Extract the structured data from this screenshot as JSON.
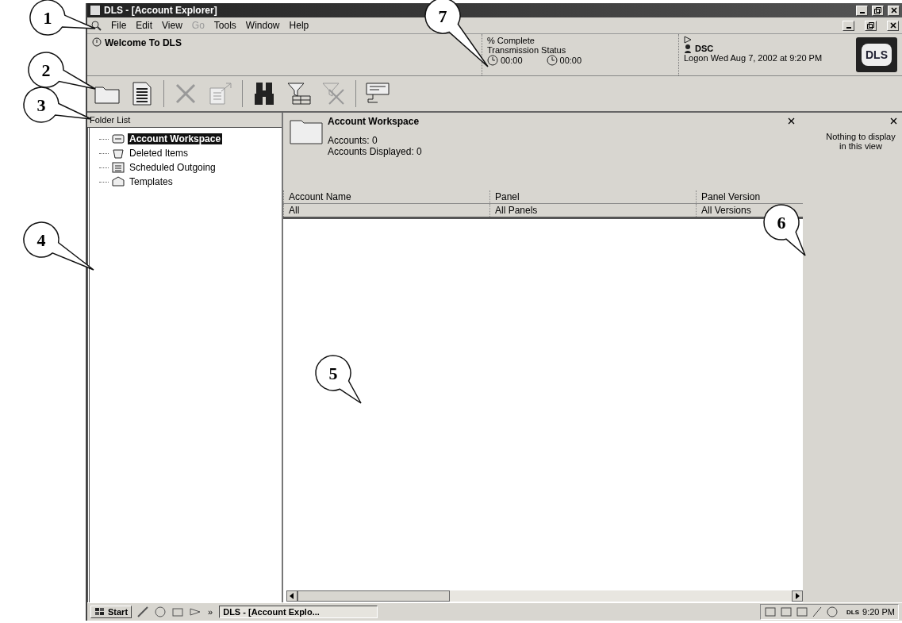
{
  "window": {
    "title": "DLS - [Account Explorer]"
  },
  "menu": [
    {
      "label": "File",
      "disabled": false
    },
    {
      "label": "Edit",
      "disabled": false
    },
    {
      "label": "View",
      "disabled": false
    },
    {
      "label": "Go",
      "disabled": true
    },
    {
      "label": "Tools",
      "disabled": false
    },
    {
      "label": "Window",
      "disabled": false
    },
    {
      "label": "Help",
      "disabled": false
    }
  ],
  "info_bar": {
    "welcome": "Welcome To DLS",
    "complete": "% Complete",
    "transmission": "Transmission Status",
    "timer_1": "00:00",
    "timer_2": "00:00",
    "user": "DSC",
    "logon": "Logon Wed Aug 7, 2002 at 9:20 PM",
    "logo": "DLS"
  },
  "toolbar": [
    {
      "kind": "folder",
      "disabled": false
    },
    {
      "kind": "document",
      "disabled": false
    },
    {
      "kind": "delete",
      "disabled": true
    },
    {
      "kind": "export",
      "disabled": true
    },
    {
      "kind": "find",
      "disabled": false
    },
    {
      "kind": "filter",
      "disabled": false
    },
    {
      "kind": "clear-filter",
      "disabled": true
    },
    {
      "kind": "connect",
      "disabled": false
    }
  ],
  "folder_list": {
    "title": "Folder List",
    "items": [
      {
        "label": "Account Workspace",
        "selected": true,
        "kind": "workspace"
      },
      {
        "label": "Deleted Items",
        "selected": false,
        "kind": "deleted"
      },
      {
        "label": "Scheduled Outgoing",
        "selected": false,
        "kind": "scheduled"
      },
      {
        "label": "Templates",
        "selected": false,
        "kind": "templates"
      }
    ]
  },
  "workspace": {
    "title": "Account Workspace",
    "accounts": "Accounts: 0",
    "displayed": "Accounts Displayed: 0",
    "columns": [
      "Account Name",
      "Panel",
      "Panel Version"
    ],
    "filters": [
      "All",
      "All Panels",
      "All Versions"
    ]
  },
  "side_pane": {
    "message": "Nothing to display in this view"
  },
  "taskbar": {
    "start": "Start",
    "chevron": "»",
    "task": "DLS - [Account Explo...",
    "tray_label": "DLS",
    "clock": "9:20 PM"
  },
  "callouts": [
    {
      "label": "1"
    },
    {
      "label": "2"
    },
    {
      "label": "3"
    },
    {
      "label": "4"
    },
    {
      "label": "5"
    },
    {
      "label": "6"
    },
    {
      "label": "7"
    }
  ]
}
